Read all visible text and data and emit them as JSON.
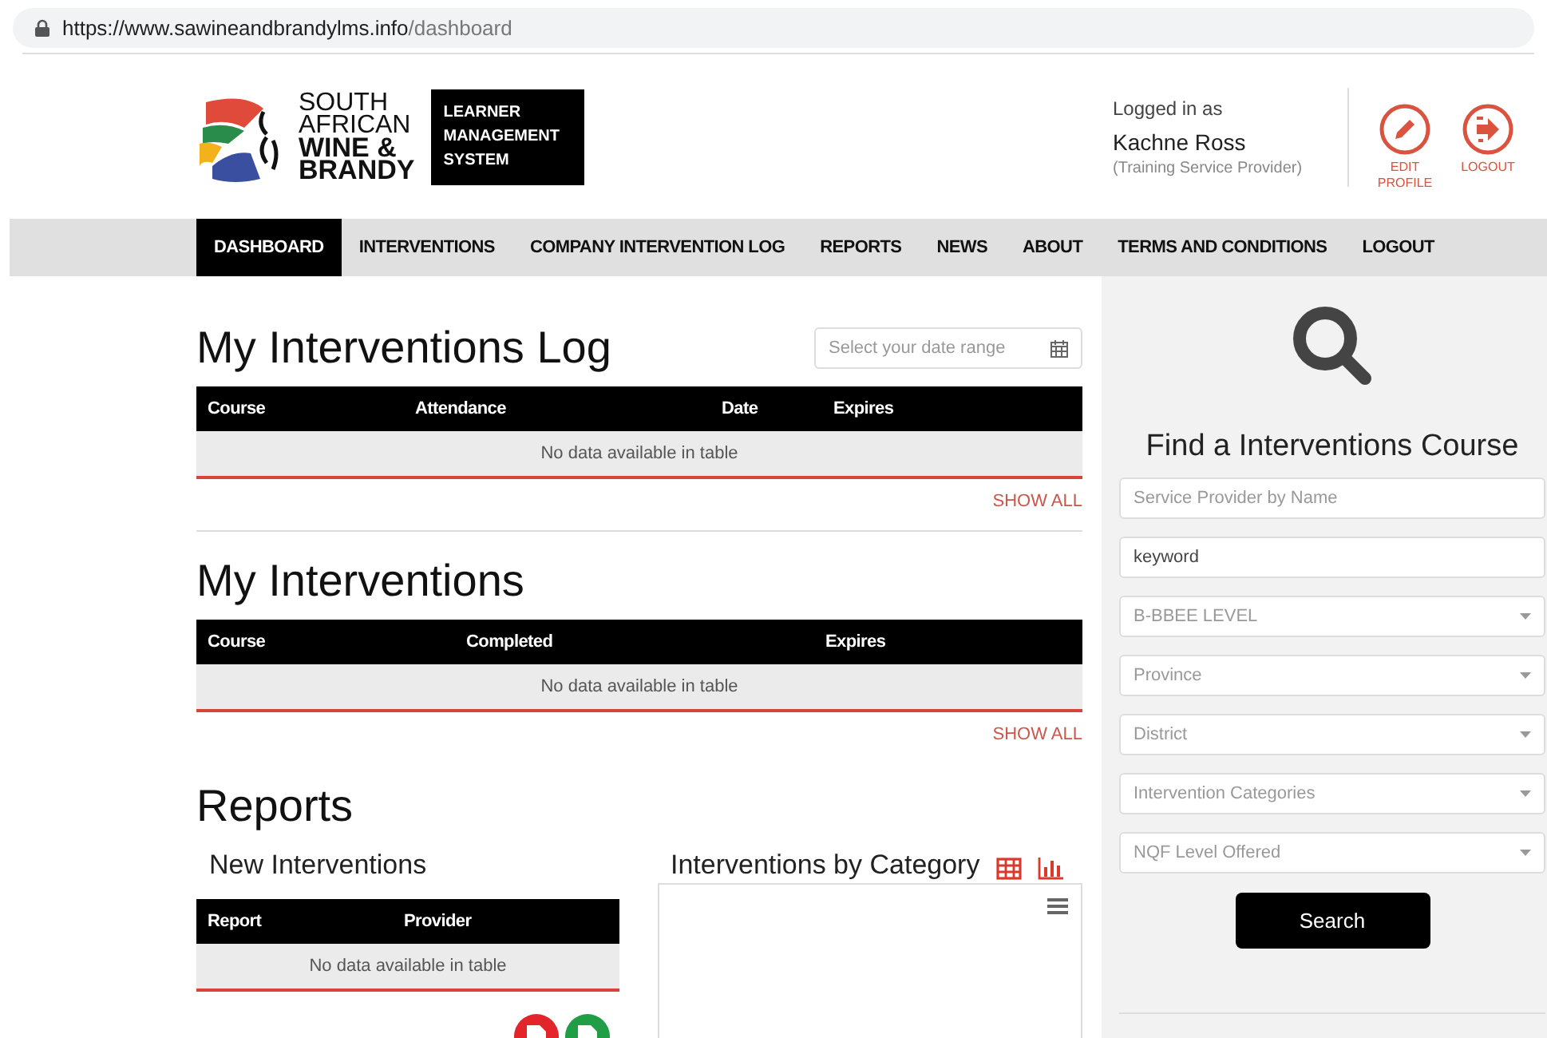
{
  "address_bar": {
    "host": "https://www.sawineandbrandylms.info",
    "path": "/dashboard"
  },
  "logo": {
    "lines": [
      "SOUTH",
      "AFRICAN",
      "WINE &",
      "BRANDY"
    ],
    "system": [
      "LEARNER",
      "MANAGEMENT",
      "SYSTEM"
    ]
  },
  "user": {
    "caption": "Logged in as",
    "name": "Kachne Ross",
    "role": "(Training Service Provider)"
  },
  "actions": [
    {
      "kind": "edit",
      "label": "EDIT PROFILE"
    },
    {
      "kind": "logout",
      "label": "LOGOUT"
    }
  ],
  "nav": [
    {
      "label": "DASHBOARD",
      "selected": true
    },
    {
      "label": "INTERVENTIONS",
      "selected": false
    },
    {
      "label": "COMPANY INTERVENTION LOG",
      "selected": false
    },
    {
      "label": "REPORTS",
      "selected": false
    },
    {
      "label": "NEWS",
      "selected": false
    },
    {
      "label": "ABOUT",
      "selected": false
    },
    {
      "label": "TERMS AND CONDITIONS",
      "selected": false
    },
    {
      "label": "LOGOUT",
      "selected": false
    }
  ],
  "interventions_log": {
    "title": "My Interventions Log",
    "date_range": {
      "placeholder": "Select your date range"
    },
    "columns": [
      "Course",
      "Attendance",
      "Date",
      "Expires"
    ],
    "empty": "No data available in table",
    "show_all": "SHOW ALL"
  },
  "interventions": {
    "title": "My Interventions",
    "columns": [
      "Course",
      "Completed",
      "Expires"
    ],
    "empty": "No data available in table",
    "show_all": "SHOW ALL"
  },
  "reports": {
    "title": "Reports",
    "new_interventions": {
      "title": "New Interventions",
      "columns": [
        "Report",
        "Provider"
      ],
      "empty": "No data available in table"
    },
    "by_category": {
      "title": "Interventions by Category"
    }
  },
  "finder": {
    "title": "Find a Interventions Course",
    "fields": [
      {
        "kind": "input",
        "placeholder": "Service Provider by Name"
      },
      {
        "kind": "input",
        "value": "keyword"
      },
      {
        "kind": "select",
        "placeholder": "B-BBEE LEVEL"
      },
      {
        "kind": "select",
        "placeholder": "Province"
      },
      {
        "kind": "select",
        "placeholder": "District"
      },
      {
        "kind": "select",
        "placeholder": "Intervention Categories"
      },
      {
        "kind": "select",
        "placeholder": "NQF Level Offered"
      }
    ],
    "button": "Search"
  }
}
